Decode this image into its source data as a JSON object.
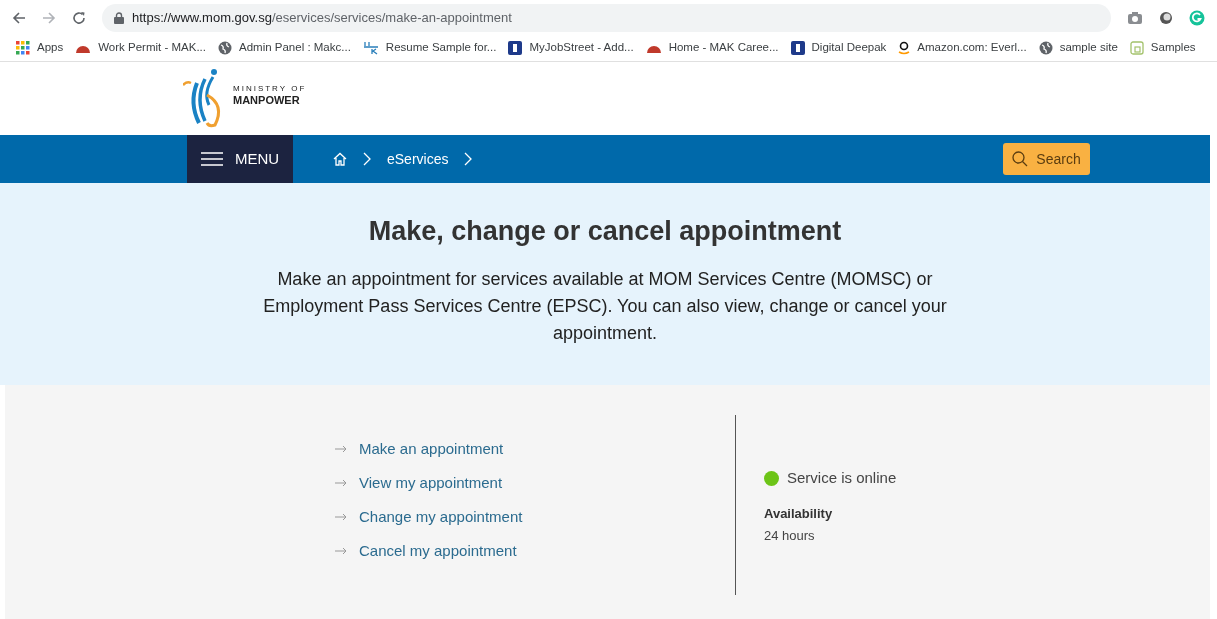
{
  "browser": {
    "url_host": "https://www.mom.gov.sg",
    "url_path": "/eservices/services/make-an-appointment"
  },
  "bookmarks": [
    {
      "label": "Apps",
      "kind": "grid"
    },
    {
      "label": "Work Permit - MAK...",
      "kind": "arch"
    },
    {
      "label": "Admin Panel : Makc...",
      "kind": "globe"
    },
    {
      "label": "Resume Sample for...",
      "kind": "letters"
    },
    {
      "label": "MyJobStreet - Add...",
      "kind": "square"
    },
    {
      "label": "Home - MAK Caree...",
      "kind": "arch"
    },
    {
      "label": "Digital Deepak",
      "kind": "square"
    },
    {
      "label": "Amazon.com: Everl...",
      "kind": "smile"
    },
    {
      "label": "sample site",
      "kind": "globe"
    },
    {
      "label": "Samples",
      "kind": "page"
    }
  ],
  "logo": {
    "line1": "MINISTRY OF",
    "line2": "MANPOWER"
  },
  "nav": {
    "menu": "MENU",
    "breadcrumb": [
      "eServices"
    ],
    "search": "Search"
  },
  "hero": {
    "title": "Make, change or cancel appointment",
    "description": "Make an appointment for services available at MOM Services Centre (MOMSC) or Employment Pass Services Centre (EPSC). You can also view, change or cancel your appointment."
  },
  "links": [
    "Make an appointment",
    "View my appointment",
    "Change my appointment",
    "Cancel my appointment"
  ],
  "status": {
    "text": "Service is online",
    "color": "#6cc417",
    "availability_label": "Availability",
    "availability_value": "24 hours"
  }
}
